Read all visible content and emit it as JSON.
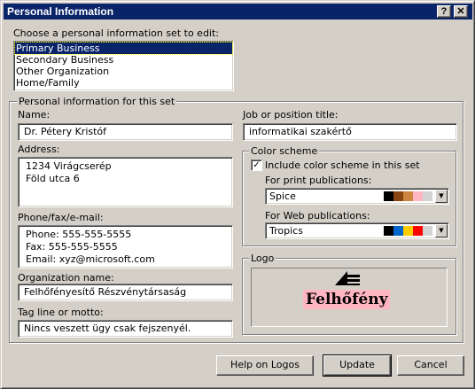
{
  "window": {
    "title": "Personal Information",
    "help_glyph": "?",
    "close_glyph": "✕"
  },
  "choose": {
    "label": "Choose a personal information set to edit:",
    "items": [
      "Primary Business",
      "Secondary Business",
      "Other Organization",
      "Home/Family"
    ],
    "selected_index": 0
  },
  "info_group": {
    "label": "Personal information for this set",
    "name_label": "Name:",
    "name_value": "Dr. Pétery Kristóf",
    "address_label": "Address:",
    "address_value": "1234 Virágcserép\nFöld utca 6",
    "phone_label": "Phone/fax/e-mail:",
    "phone_value": "Phone: 555-555-5555\nFax: 555-555-5555\nEmail: xyz@microsoft.com",
    "org_label": "Organization name:",
    "org_value": "Felhőfényesítő Részvénytársaság",
    "tagline_label": "Tag line or motto:",
    "tagline_value": "Nincs veszett ügy csak fejszenyél.",
    "job_label": "Job or position title:",
    "job_value": "informatikai szakértő"
  },
  "color_scheme": {
    "label": "Color scheme",
    "include_label": "Include color scheme in this set",
    "include_checked": true,
    "check_glyph": "✓",
    "print_label": "For print publications:",
    "print_value": "Spice",
    "print_colors": [
      "#000000",
      "#8b4513",
      "#cd853f",
      "#ffb6c1",
      "#d3d3d3",
      "#ffffff"
    ],
    "web_label": "For Web publications:",
    "web_value": "Tropics",
    "web_colors": [
      "#000000",
      "#0066cc",
      "#ffcc00",
      "#ff0000",
      "#d3d3d3",
      "#ffffff"
    ],
    "dropdown_glyph": "▼"
  },
  "logo": {
    "label": "Logo",
    "text": "Felhőfény",
    "background": "#ffb6c1"
  },
  "buttons": {
    "help_logos": "Help on Logos",
    "update": "Update",
    "cancel": "Cancel"
  }
}
